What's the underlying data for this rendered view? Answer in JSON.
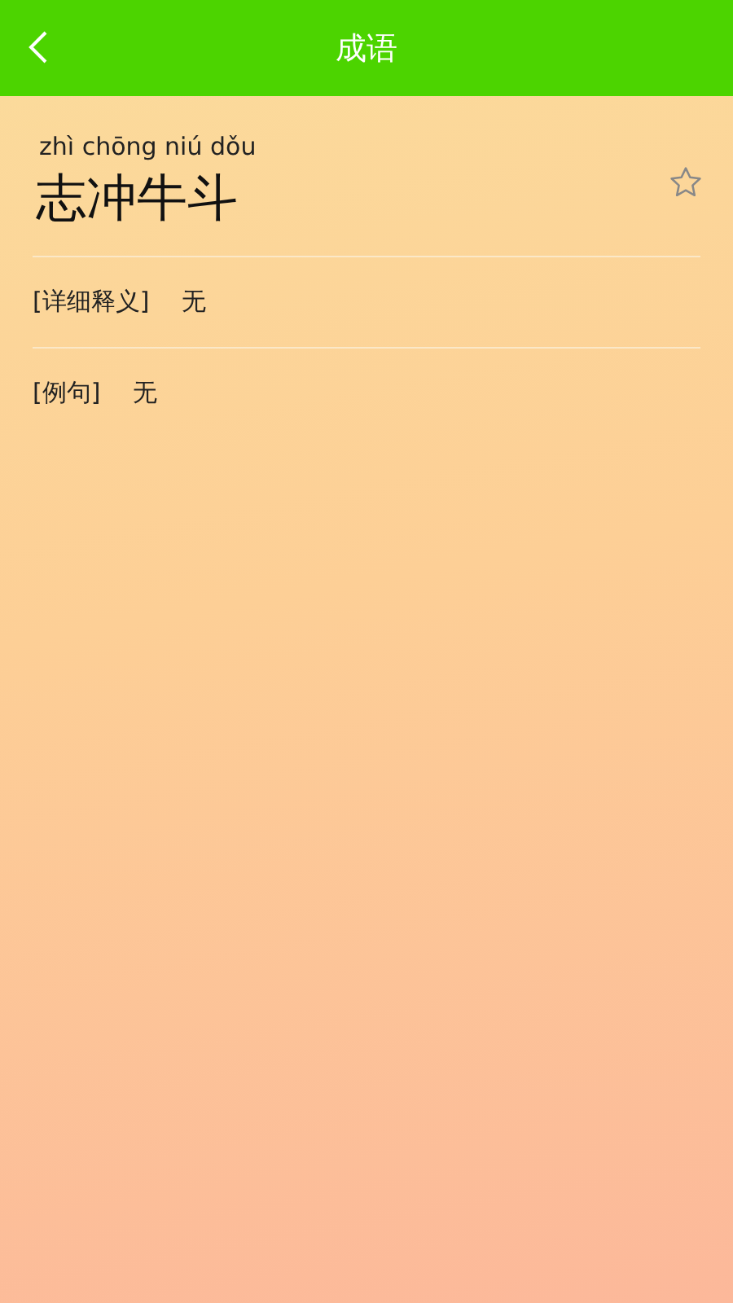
{
  "header": {
    "title": "成语"
  },
  "idiom": {
    "pinyin": "zhì chōng niú dǒu",
    "text": "志冲牛斗",
    "favorited": false
  },
  "fields": [
    {
      "label": "[详细释义]",
      "value": "无"
    },
    {
      "label": "[例句]",
      "value": "无"
    }
  ]
}
